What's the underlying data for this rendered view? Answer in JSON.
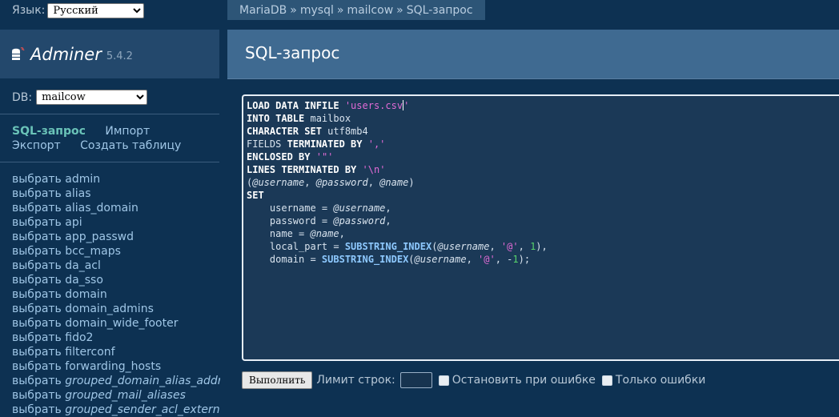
{
  "language": {
    "label": "Язык:",
    "selected": "Русский"
  },
  "app": {
    "name": "Adminer",
    "version": "5.4.2"
  },
  "db": {
    "label": "DB:",
    "selected": "mailcow"
  },
  "nav_links": {
    "row1": [
      "SQL-запрос",
      "Импорт"
    ],
    "row2": [
      "Экспорт",
      "Создать таблицу"
    ]
  },
  "tables_prefix": "выбрать",
  "tables": [
    "admin",
    "alias",
    "alias_domain",
    "api",
    "app_passwd",
    "bcc_maps",
    "da_acl",
    "da_sso",
    "domain",
    "domain_admins",
    "domain_wide_footer",
    "fido2",
    "filterconf",
    "forwarding_hosts",
    "grouped_domain_alias_address",
    "grouped_mail_aliases",
    "grouped_sender_acl_external"
  ],
  "tables_italic": [
    "grouped_domain_alias_address",
    "grouped_mail_aliases",
    "grouped_sender_acl_external"
  ],
  "breadcrumb": {
    "items": [
      "MariaDB",
      "mysql",
      "mailcow"
    ],
    "current": "SQL-запрос",
    "separator": "»"
  },
  "page_title": "SQL-запрос",
  "sql_lines": [
    [
      [
        "k",
        "LOAD DATA INFILE "
      ],
      [
        "s",
        "'users.csv"
      ],
      [
        "caret",
        ""
      ],
      [
        "s",
        "'"
      ]
    ],
    [
      [
        "k",
        "INTO TABLE"
      ],
      [
        "t",
        " mailbox"
      ]
    ],
    [
      [
        "k",
        "CHARACTER SET"
      ],
      [
        "t",
        " utf8mb4"
      ]
    ],
    [
      [
        "t",
        "FIELDS "
      ],
      [
        "k",
        "TERMINATED BY"
      ],
      [
        "t",
        " "
      ],
      [
        "s",
        "','"
      ]
    ],
    [
      [
        "k",
        "ENCLOSED BY"
      ],
      [
        "t",
        " "
      ],
      [
        "s",
        "'\"'"
      ]
    ],
    [
      [
        "k",
        "LINES TERMINATED BY"
      ],
      [
        "t",
        " "
      ],
      [
        "s",
        "'\\n'"
      ]
    ],
    [
      [
        "t",
        "("
      ],
      [
        "v",
        "@username"
      ],
      [
        "t",
        ", "
      ],
      [
        "v",
        "@password"
      ],
      [
        "t",
        ", "
      ],
      [
        "v",
        "@name"
      ],
      [
        "t",
        ")"
      ]
    ],
    [
      [
        "k",
        "SET"
      ]
    ],
    [
      [
        "t",
        "    username = "
      ],
      [
        "v",
        "@username"
      ],
      [
        "t",
        ","
      ]
    ],
    [
      [
        "t",
        "    password = "
      ],
      [
        "v",
        "@password"
      ],
      [
        "t",
        ","
      ]
    ],
    [
      [
        "t",
        "    name = "
      ],
      [
        "v",
        "@name"
      ],
      [
        "t",
        ","
      ]
    ],
    [
      [
        "t",
        "    local_part = "
      ],
      [
        "f",
        "SUBSTRING_INDEX"
      ],
      [
        "t",
        "("
      ],
      [
        "v",
        "@username"
      ],
      [
        "t",
        ", "
      ],
      [
        "s",
        "'@'"
      ],
      [
        "t",
        ", "
      ],
      [
        "n",
        "1"
      ],
      [
        "t",
        "),"
      ]
    ],
    [
      [
        "t",
        "    domain = "
      ],
      [
        "f",
        "SUBSTRING_INDEX"
      ],
      [
        "t",
        "("
      ],
      [
        "v",
        "@username"
      ],
      [
        "t",
        ", "
      ],
      [
        "s",
        "'@'"
      ],
      [
        "t",
        ", -"
      ],
      [
        "n",
        "1"
      ],
      [
        "t",
        ");"
      ]
    ]
  ],
  "actions": {
    "run_label": "Выполнить",
    "limit_label": "Лимит строк:",
    "limit_value": "",
    "stop_on_error": "Остановить при ошибке",
    "only_errors": "Только ошибки"
  }
}
